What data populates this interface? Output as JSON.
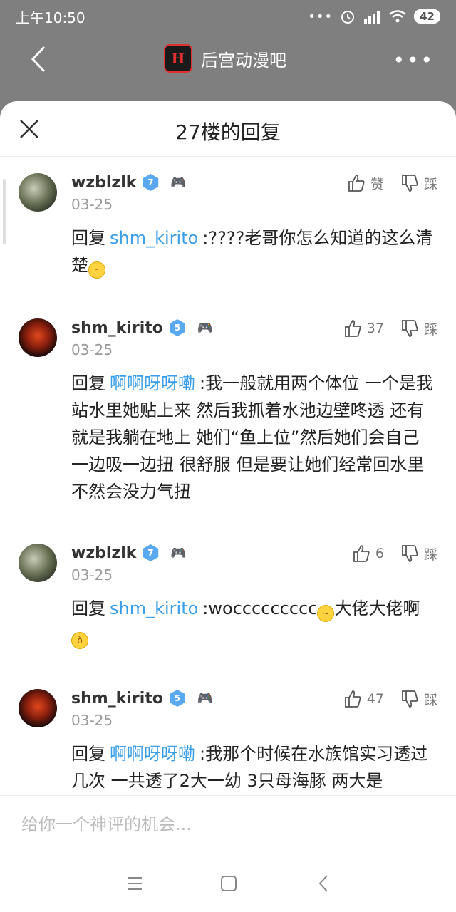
{
  "status_bar": {
    "time": "上午10:50",
    "dots": "•••",
    "battery": "42"
  },
  "header": {
    "forum_name": "后宫动漫吧"
  },
  "sheet": {
    "title": "27楼的回复"
  },
  "labels": {
    "reply_prefix": "回复",
    "like": "赞",
    "dislike": "踩"
  },
  "replies": [
    {
      "username": "wzblzlk",
      "level": "7",
      "date": "03-25",
      "reply_to": "shm_kirito",
      "likes": "",
      "text": ":????老哥你怎么知道的这么清楚",
      "emoji": "😊"
    },
    {
      "username": "shm_kirito",
      "level": "5",
      "date": "03-25",
      "reply_to": "啊啊呀呀嘞",
      "likes": "37",
      "text": ":我一般就用两个体位 一个是我站水里她贴上来 然后我抓着水池边壁咚透 还有就是我躺在地上 她们“鱼上位”然后她们会自己一边吸一边扭 很舒服 但是要让她们经常回水里 不然会没力气扭",
      "emoji": ""
    },
    {
      "username": "wzblzlk",
      "level": "7",
      "date": "03-25",
      "reply_to": "shm_kirito",
      "likes": "6",
      "text": ":woccccccccc",
      "text_after": "大佬大佬啊",
      "emoji": "😋",
      "emoji2": "😠"
    },
    {
      "username": "shm_kirito",
      "level": "5",
      "date": "03-25",
      "reply_to": "啊啊呀呀嘞",
      "likes": "47",
      "text": ":我那个时候在水族馆实习透过几次 一共透了2大一幼 3只母海豚 两大是",
      "emoji": ""
    }
  ],
  "input": {
    "placeholder": "给你一个神评的机会..."
  }
}
